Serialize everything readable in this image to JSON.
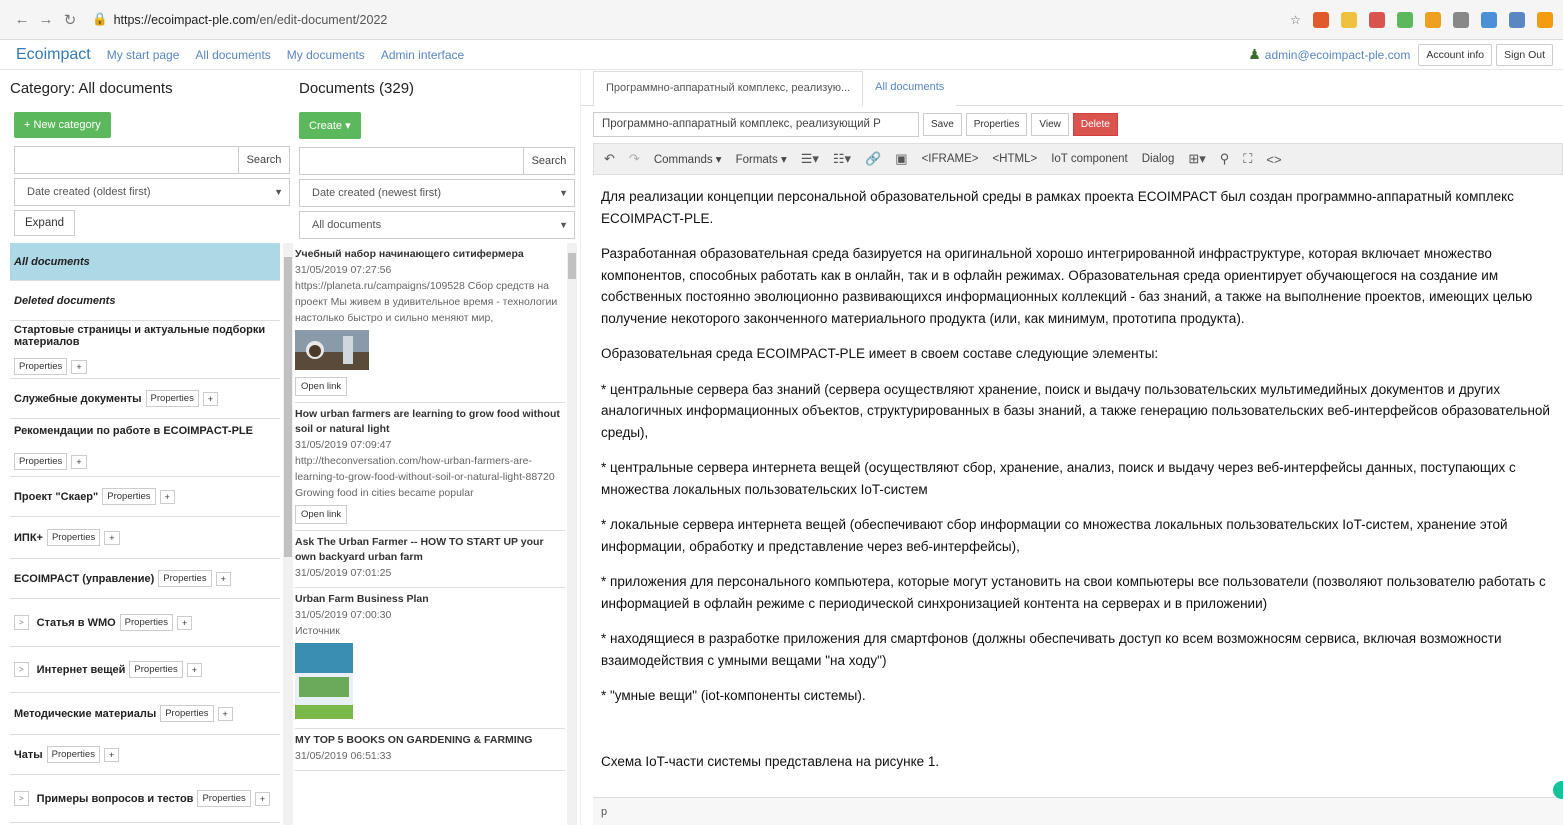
{
  "browser": {
    "url_host": "https://ecoimpact-ple.com",
    "url_path": "/en/edit-document/2022",
    "ext_colors": [
      "#e05a2b",
      "#f0c040",
      "#d9534f",
      "#5cb85c",
      "#f0a020",
      "#888888",
      "#4a90d9",
      "#5a86c1",
      "#f39c12"
    ]
  },
  "nav": {
    "brand": "Ecoimpact",
    "links": [
      "My start page",
      "All documents",
      "My documents",
      "Admin interface"
    ],
    "user_email": "admin@ecoimpact-ple.com",
    "account_info": "Account info",
    "sign_out": "Sign Out"
  },
  "categories": {
    "heading": "Category: All documents",
    "new_button": "+ New category",
    "search_button": "Search",
    "sort": "Date created (oldest first)",
    "expand": "Expand",
    "props_label": "Properties",
    "plus_label": "+",
    "items": [
      {
        "label": "All documents",
        "selected": true,
        "italic": true,
        "props": false,
        "expander": false,
        "height": 38
      },
      {
        "label": "Deleted documents",
        "selected": false,
        "italic": true,
        "props": false,
        "expander": false,
        "height": 40
      },
      {
        "label": "Стартовые страницы и актуальные подборки материалов",
        "selected": false,
        "italic": false,
        "props": true,
        "expander": false,
        "height": 58
      },
      {
        "label": "Служебные документы",
        "selected": false,
        "italic": false,
        "props": true,
        "expander": false,
        "height": 40
      },
      {
        "label": "Рекомендации по работе в ECOIMPACT-PLE",
        "selected": false,
        "italic": false,
        "props": true,
        "expander": false,
        "height": 58
      },
      {
        "label": "Проект \"Скаер\"",
        "selected": false,
        "italic": false,
        "props": true,
        "expander": false,
        "height": 40
      },
      {
        "label": "ИПК+",
        "selected": false,
        "italic": false,
        "props": true,
        "expander": false,
        "height": 42
      },
      {
        "label": "ECOIMPACT (управление)",
        "selected": false,
        "italic": false,
        "props": true,
        "expander": false,
        "height": 40
      },
      {
        "label": "Статья в WMO",
        "selected": false,
        "italic": false,
        "props": true,
        "expander": true,
        "height": 48
      },
      {
        "label": "Интернет вещей",
        "selected": false,
        "italic": false,
        "props": true,
        "expander": true,
        "height": 46
      },
      {
        "label": "Методические материалы",
        "selected": false,
        "italic": false,
        "props": true,
        "expander": false,
        "height": 42
      },
      {
        "label": "Чаты",
        "selected": false,
        "italic": false,
        "props": true,
        "expander": false,
        "height": 40
      },
      {
        "label": "Примеры вопросов и тестов",
        "selected": false,
        "italic": false,
        "props": true,
        "expander": true,
        "height": 48
      }
    ]
  },
  "documents": {
    "heading": "Documents (329)",
    "create_button": "Create ▾",
    "search_button": "Search",
    "sort": "Date created (newest first)",
    "filter": "All documents",
    "open_link": "Open link",
    "items": [
      {
        "title": "Учебный набор начинающего ситифермера",
        "date": "31/05/2019 07:27:56",
        "excerpt": "https://planeta.ru/campaigns/109528 Сбор средств на проект Мы живем в удивительное время - технологии настолько быстро и сильно меняют мир,",
        "image": "photo",
        "link": true
      },
      {
        "title": "How urban farmers are learning to grow food without soil or natural light",
        "date": "31/05/2019 07:09:47",
        "excerpt": "http://theconversation.com/how-urban-farmers-are-learning-to-grow-food-without-soil-or-natural-light-88720 Growing food in cities became popular",
        "image": "",
        "link": true
      },
      {
        "title": "Ask The Urban Farmer -- HOW TO START UP your own backyard urban farm",
        "date": "31/05/2019 07:01:25",
        "excerpt": "",
        "image": "",
        "link": false
      },
      {
        "title": "Urban Farm Business Plan",
        "date": "31/05/2019 07:00:30",
        "excerpt": "Источник",
        "image": "book",
        "link": false
      },
      {
        "title": "MY TOP 5 BOOKS ON GARDENING & FARMING",
        "date": "31/05/2019 06:51:33",
        "excerpt": "",
        "image": "",
        "link": false
      }
    ]
  },
  "editor": {
    "tab_active": "Программно-аппаратный комплекс, реализую...",
    "tab_link": "All documents",
    "title_value": "Программно-аппаратный комплекс, реализующий Р",
    "save": "Save",
    "properties": "Properties",
    "view": "View",
    "delete": "Delete",
    "toolbar": {
      "commands": "Commands ▾",
      "formats": "Formats ▾",
      "iframe": "<IFRAME>",
      "html": "<HTML>",
      "iot": "IoT component",
      "dialog": "Dialog"
    },
    "paragraphs": [
      "Для реализации концепции персональной образовательной среды в рамках проекта ECOIMPACT был создан программно-аппаратный комплекс ECOIMPACT-PLE.",
      "Разработанная образовательная среда базируется на оригинальной хорошо интегрированной инфраструктуре, которая включает множество компонентов, способных  работать как в онлайн, так и в офлайн режимах. Образовательная среда ориентирует обучающегося на создание им собственных постоянно эволюционно развивающихся информационных коллекций - баз знаний, а также на выполнение проектов, имеющих  целью получение некоторого законченного материального продукта (или, как минимум, прототипа продукта).",
      "Образовательная среда ECOIMPACT-PLE имеет в своем составе следующие элементы:",
      "* центральные сервера баз знаний (сервера осуществляют хранение, поиск и выдачу пользовательских мультимедийных документов и других аналогичных информационных объектов, структурированных в базы знаний, а также генерацию пользовательских веб-интерфейсов образовательной среды),",
      "* центральные сервера интернета вещей (осуществляют сбор, хранение, анализ, поиск и выдачу через веб-интерфейсы данных, поступающих с множества локальных пользовательских IoT-систем",
      "* локальные сервера интернета вещей (обеспечивают сбор информации со множества локальных пользовательских IoT-систем, хранение этой информации, обработку и представление через веб-интерфейсы),",
      "* приложения для персонального компьютера, которые могут установить на свои компьютеры все пользователи (позволяют пользователю работать с информацией в офлайн режиме с периодической синхронизацией контента на серверах и в приложении)",
      "* находящиеся в разработке приложения для смартфонов (должны обеспечивать доступ ко всем возможносям сервиса, включая возможности взаимодействия с умными вещами \"на ходу\")",
      "* \"умные вещи\" (iot-компоненты системы)."
    ],
    "last_paragraph": "Схема IoT-части системы представлена на рисунке 1.",
    "status": "p"
  }
}
